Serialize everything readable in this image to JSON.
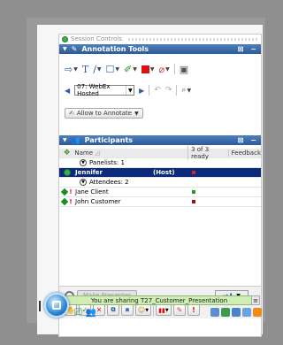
{
  "session_controls": {
    "title": "Session Controls"
  },
  "annotation_tools": {
    "title": "Annotation Tools",
    "page_select": "07: WebEx Hosted",
    "allow_label": "Allow to Annotate"
  },
  "participants": {
    "title": "Participants",
    "columns": {
      "name": "Name",
      "ready": "3 of 3 ready",
      "feedback": "Feedback"
    },
    "panelists_label": "Panelists: 1",
    "host_name": "Jennifer",
    "host_tag": "(Host)",
    "attendees_label": "Attendees: 2",
    "attendees": [
      {
        "name": "Jane Client",
        "status_color": "#1f9a1f"
      },
      {
        "name": "John Customer",
        "status_color": "#a01010"
      }
    ]
  },
  "bottom": {
    "make_presenter": "Make Presenter"
  },
  "share": {
    "text": "You are sharing T27_Customer_Presentation"
  },
  "colors": {
    "header_blue": "#2c5b99",
    "host_row": "#0c2a7a",
    "share_bg": "#cfeeb3"
  }
}
